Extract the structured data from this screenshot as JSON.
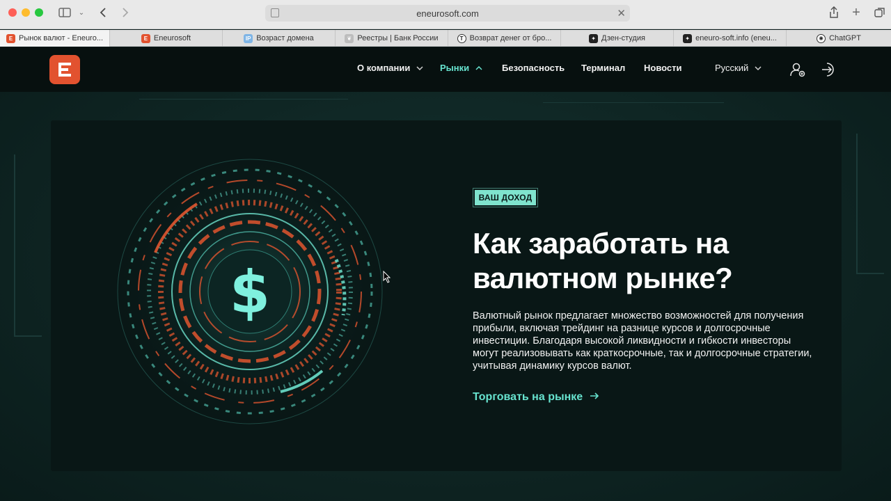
{
  "browser": {
    "url": "eneurosoft.com",
    "tabs": [
      {
        "label": "Рынок валют - Eneuro...",
        "favicon": "eneurosoft-logo",
        "active": true
      },
      {
        "label": "Eneurosoft",
        "favicon": "eneurosoft-logo",
        "active": false
      },
      {
        "label": "Возраст домена",
        "favicon": "ip-icon",
        "active": false
      },
      {
        "label": "Реестры | Банк России",
        "favicon": "bank-of-russia-icon",
        "active": false
      },
      {
        "label": "Возврат денег от бро...",
        "favicon": "t-icon",
        "active": false
      },
      {
        "label": "Дзен-студия",
        "favicon": "dzen-icon",
        "active": false
      },
      {
        "label": "eneuro-soft.info (eneu...",
        "favicon": "dzen-icon",
        "active": false
      },
      {
        "label": "ChatGPT",
        "favicon": "chatgpt-icon",
        "active": false
      }
    ]
  },
  "header": {
    "nav": [
      {
        "label": "О компании",
        "has_dropdown": true,
        "active": false
      },
      {
        "label": "Рынки",
        "has_dropdown": true,
        "active": true
      },
      {
        "label": "Безопасность",
        "has_dropdown": false,
        "active": false
      },
      {
        "label": "Терминал",
        "has_dropdown": false,
        "active": false
      },
      {
        "label": "Новости",
        "has_dropdown": false,
        "active": false
      }
    ],
    "language": "Русский",
    "icons": [
      "user-add-icon",
      "login-icon"
    ]
  },
  "hero": {
    "badge": "ВАШ ДОХОД",
    "title_line1": "Как заработать на",
    "title_line2": "валютном рынке?",
    "description": "Валютный рынок предлагает множество возможностей для получения прибыли, включая трейдинг на разнице курсов и долгосрочные инвестиции. Благодаря высокой ликвидности и гибкости инвесторы могут реализовывать как краткосрочные, так и долгосрочные стратегии, учитывая динамику курсов валют.",
    "cta": "Торговать на рынке",
    "graphic_symbol": "$"
  },
  "colors": {
    "accent": "#67e3cf",
    "brand": "#e2522f",
    "background": "#091716"
  }
}
